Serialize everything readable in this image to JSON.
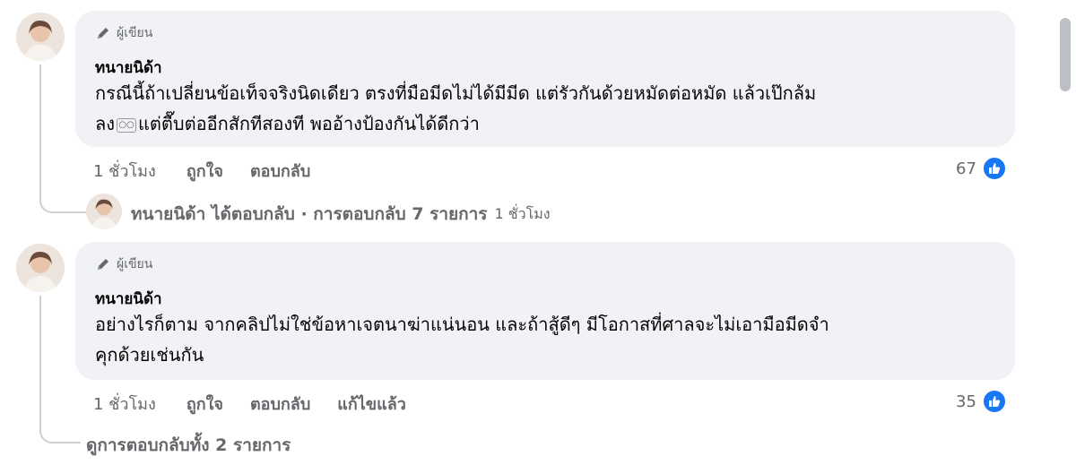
{
  "comment1": {
    "badge": "ผู้เขียน",
    "author": "ทนายนิด้า",
    "line1": "กรณีนี้ถ้าเปลี่ยนข้อเท็จจริงนิดเดียว ตรงที่มือมีดไม่ได้มีมีด แต่รัวกันด้วยหมัดต่อหมัด แล้วเป๊กล้ม",
    "line2_pre": "ลง",
    "line2_post": "แต่ตื๊บต่ออีกสักทีสองที พออ้างป้องกันได้ดีกว่า",
    "time": "1 ชั่วโมง",
    "like": "ถูกใจ",
    "reply": "ตอบกลับ",
    "reaction_count": "67"
  },
  "replies_summary": {
    "text": "ทนายนิด้า ได้ตอบกลับ · การตอบกลับ 7 รายการ",
    "time": "1 ชั่วโมง"
  },
  "comment2": {
    "badge": "ผู้เขียน",
    "author": "ทนายนิด้า",
    "line1": "อย่างไรก็ตาม จากคลิปไม่ใช่ข้อหาเจตนาฆ่าแน่นอน และถ้าสู้ดีๆ มีโอกาสที่ศาลจะไม่เอามือมีดจำ",
    "line2": "คุกด้วยเช่นกัน",
    "time": "1 ชั่วโมง",
    "like": "ถูกใจ",
    "reply": "ตอบกลับ",
    "edited": "แก้ไขแล้ว",
    "reaction_count": "35"
  },
  "view_all": "ดูการตอบกลับทั้ง 2 รายการ",
  "icons": {
    "badge": "pencil-icon",
    "reaction": "like-icon",
    "inline": "emoji-icon"
  },
  "colors": {
    "bubble": "#f0f2f5",
    "like_blue": "#1877f2",
    "secondary_text": "#65676b"
  }
}
